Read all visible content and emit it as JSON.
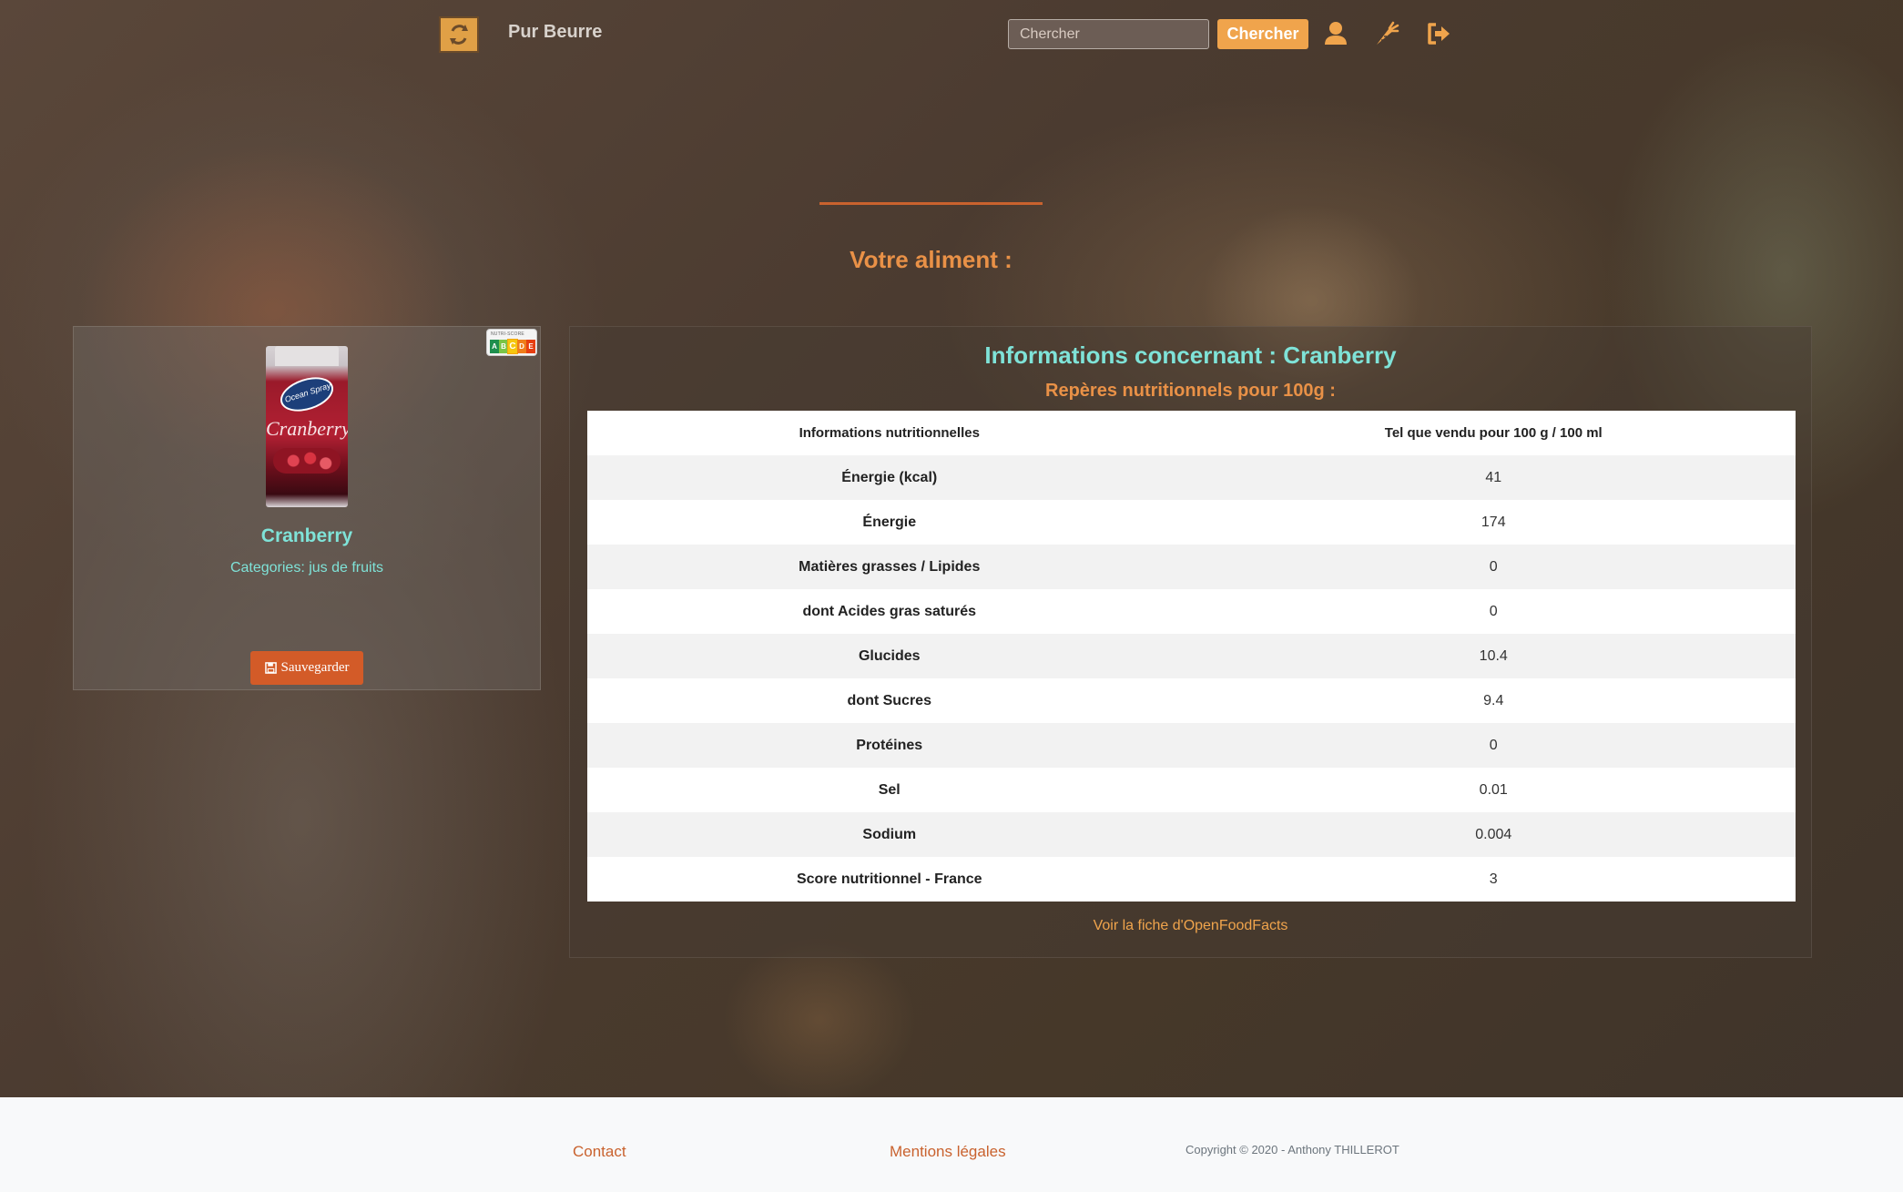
{
  "navbar": {
    "brand": "Pur Beurre",
    "search_placeholder": "Chercher",
    "search_button": "Chercher",
    "icons": [
      "user-icon",
      "carrot-icon",
      "sign-out-icon"
    ]
  },
  "heading": "Votre aliment :",
  "product": {
    "name": "Cranberry",
    "categories": "Categories: jus de fruits",
    "save_label": "Sauvegarder",
    "nutriscore_grade": "C",
    "nutriscore_title": "NUTRI-SCORE",
    "nutriscore_letters": [
      "A",
      "B",
      "C",
      "D",
      "E"
    ],
    "package_text": {
      "brand": "Ocean Spray",
      "label": "Cranberry"
    }
  },
  "info": {
    "title": "Informations concernant : Cranberry",
    "subtitle": "Repères nutritionnels pour 100g :",
    "table": {
      "headers": [
        "Informations nutritionnelles",
        "Tel que vendu pour 100 g / 100 ml"
      ],
      "rows": [
        {
          "label": "Énergie (kcal)",
          "value": "41"
        },
        {
          "label": "Énergie",
          "value": "174"
        },
        {
          "label": "Matières grasses / Lipides",
          "value": "0"
        },
        {
          "label": "dont Acides gras saturés",
          "value": "0"
        },
        {
          "label": "Glucides",
          "value": "10.4"
        },
        {
          "label": "dont Sucres",
          "value": "9.4"
        },
        {
          "label": "Protéines",
          "value": "0"
        },
        {
          "label": "Sel",
          "value": "0.01"
        },
        {
          "label": "Sodium",
          "value": "0.004"
        },
        {
          "label": "Score nutritionnel - France",
          "value": "3"
        }
      ]
    },
    "off_link": "Voir la fiche d'OpenFoodFacts"
  },
  "footer": {
    "contact": "Contact",
    "legal": "Mentions légales",
    "copyright": "Copyright © 2020 - Anthony THILLEROT"
  },
  "colors": {
    "accent_orange": "#e99147",
    "accent_teal": "#7fe3d8",
    "button_orange": "#f0a44c",
    "save_red": "#d35b28",
    "link_rust": "#c9622e"
  }
}
